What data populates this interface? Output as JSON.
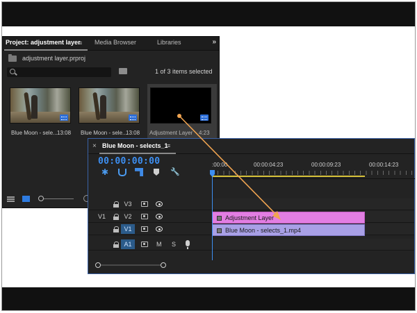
{
  "project_panel": {
    "tabs": [
      "Project: adjustment layer",
      "Media Browser",
      "Libraries"
    ],
    "menu_glyph": "≡",
    "more_glyph": "»",
    "file_name": "adjustment layer.prproj",
    "items_count": "1 of 3 items selected",
    "items": [
      {
        "name": "Blue Moon - sele...",
        "duration": "13:08",
        "kind": "video"
      },
      {
        "name": "Blue Moon - sele...",
        "duration": "13:08",
        "kind": "video"
      },
      {
        "name": "Adjustment Layer",
        "duration": "4:23",
        "kind": "adjustment",
        "selected": true
      }
    ],
    "badge_color": "#2e6fd8"
  },
  "timeline_panel": {
    "title": "Blue Moon - selects_1",
    "close_glyph": "×",
    "menu_glyph": "≡",
    "timecode": "00:00:00:00",
    "timecode_color": "#3d8ff2",
    "ruler_labels": [
      ":00:00",
      "00:00:04:23",
      "00:00:09:23",
      "00:00:14:23"
    ],
    "work_area_color": "#d8c23a",
    "tracks": [
      {
        "src": "",
        "name": "V3",
        "active": false
      },
      {
        "src": "V1",
        "name": "V2",
        "active": false
      },
      {
        "src": "",
        "name": "V1",
        "active": true
      },
      {
        "src": "",
        "name": "A1",
        "active": true,
        "audio": true,
        "mute_label": "M",
        "solo_label": "S"
      }
    ],
    "clips": [
      {
        "name": "Adjustment Layer",
        "track": "V2",
        "color": "#e27ee2"
      },
      {
        "name": "Blue Moon - selects_1.mp4",
        "track": "V1",
        "color": "#a9a0e6"
      }
    ]
  },
  "annotation": {
    "arrow_color": "#f0a451"
  }
}
